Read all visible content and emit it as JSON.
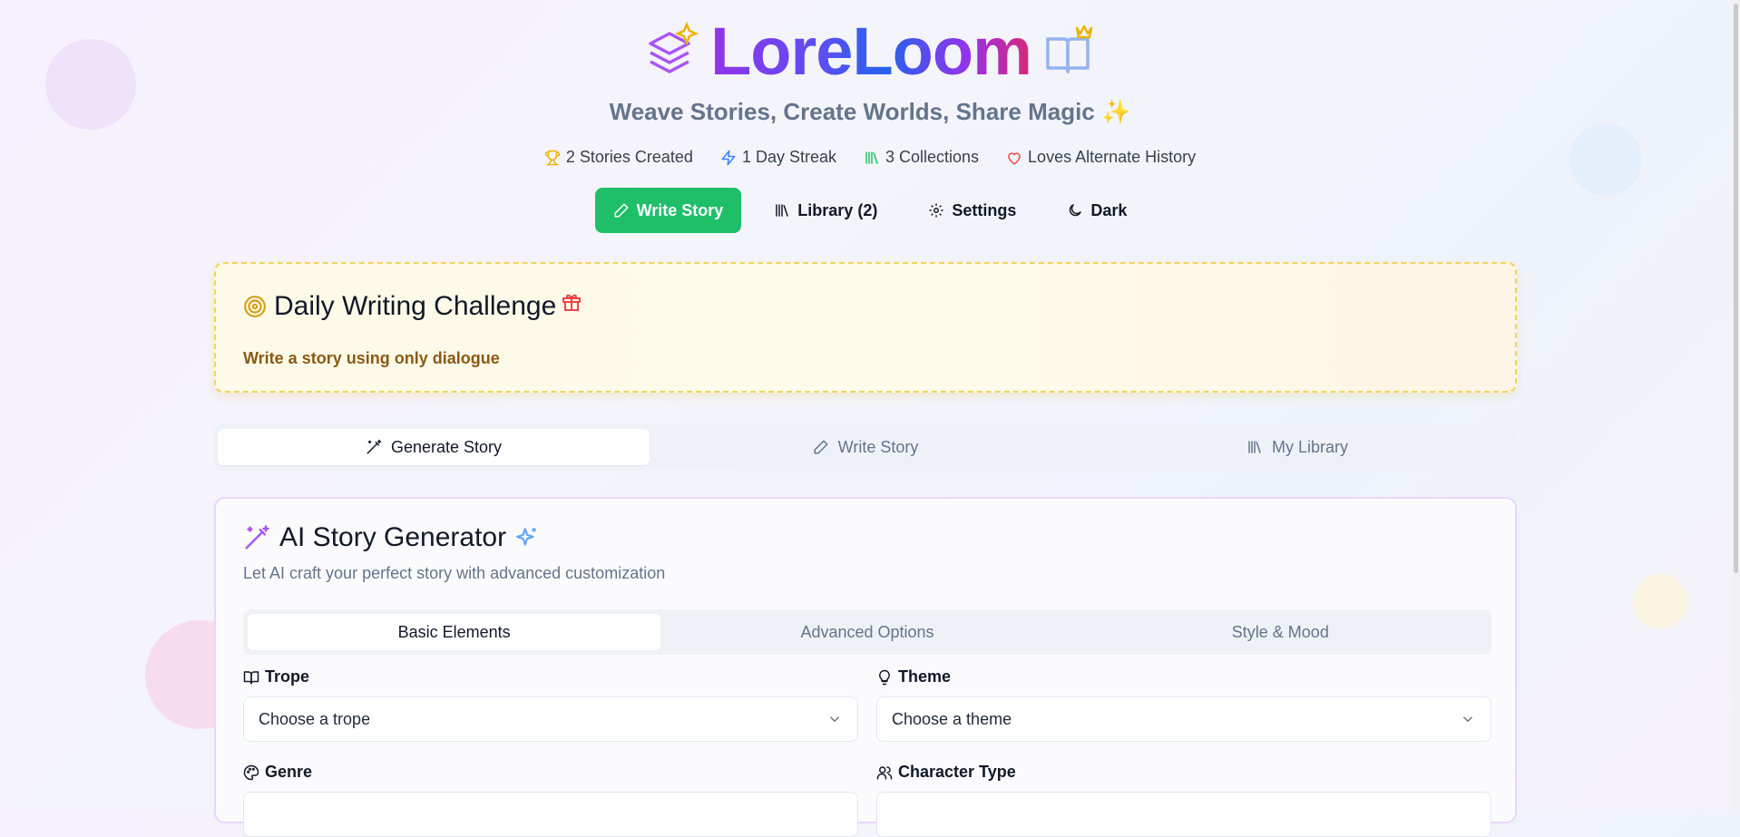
{
  "app": {
    "title": "LoreLoom",
    "tagline": "Weave Stories, Create Worlds, Share Magic",
    "tagline_emoji": "✨"
  },
  "stats": [
    {
      "icon": "trophy-icon",
      "label": "2 Stories Created"
    },
    {
      "icon": "lightning-icon",
      "label": "1 Day Streak"
    },
    {
      "icon": "library-icon",
      "label": "3 Collections"
    },
    {
      "icon": "heart-icon",
      "label": "Loves Alternate History"
    }
  ],
  "nav": {
    "write_story": "Write Story",
    "library": "Library (2)",
    "settings": "Settings",
    "dark": "Dark"
  },
  "challenge": {
    "title": "Daily Writing Challenge",
    "prompt": "Write a story using only dialogue"
  },
  "tabs": [
    {
      "label": "Generate Story",
      "icon": "magic-wand-icon",
      "active": true
    },
    {
      "label": "Write Story",
      "icon": "pencil-icon",
      "active": false
    },
    {
      "label": "My Library",
      "icon": "library-icon",
      "active": false
    }
  ],
  "generator": {
    "title": "AI Story Generator",
    "subtitle": "Let AI craft your perfect story with advanced customization",
    "subtabs": [
      "Basic Elements",
      "Advanced Options",
      "Style & Mood"
    ],
    "fields": {
      "trope": {
        "label": "Trope",
        "placeholder": "Choose a trope"
      },
      "theme": {
        "label": "Theme",
        "placeholder": "Choose a theme"
      },
      "genre": {
        "label": "Genre"
      },
      "character_type": {
        "label": "Character Type"
      }
    }
  },
  "colors": {
    "primary_button": "#1fbf6a",
    "title_gradient_start": "#9333ea",
    "title_gradient_mid": "#2563eb",
    "title_gradient_end": "#db2777",
    "challenge_border": "#f2d35a"
  }
}
